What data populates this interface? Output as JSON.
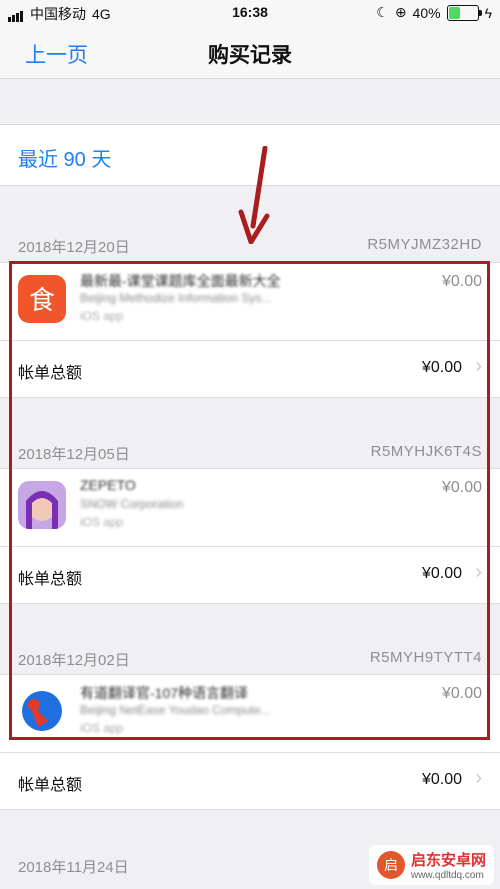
{
  "status": {
    "carrier": "中国移动",
    "network": "4G",
    "time": "16:38",
    "battery_pct": "40%",
    "battery_fill": 0.4
  },
  "nav": {
    "back_label": "上一页",
    "title": "购买记录"
  },
  "filter": {
    "label": "最近 90 天"
  },
  "sections": [
    {
      "date": "2018年12月20日",
      "order_id": "R5MYJMZ32HD",
      "item": {
        "name": "最新最-课堂课题库全面最新大全",
        "developer": "Beijing Methodize Information Sys...",
        "platform": "iOS app",
        "price": "¥0.00",
        "icon": "book-app-icon"
      },
      "total_label": "帐单总额",
      "total_amount": "¥0.00"
    },
    {
      "date": "2018年12月05日",
      "order_id": "R5MYHJK6T4S",
      "item": {
        "name": "ZEPETO",
        "developer": "SNOW Corporation",
        "platform": "iOS app",
        "price": "¥0.00",
        "icon": "avatar-app-icon"
      },
      "total_label": "帐单总额",
      "total_amount": "¥0.00"
    },
    {
      "date": "2018年12月02日",
      "order_id": "R5MYH9TYTT4",
      "item": {
        "name": "有道翻译官-107种语言翻译",
        "developer": "Beijing NetEase Youdao Compute...",
        "platform": "iOS app",
        "price": "¥0.00",
        "icon": "translate-app-icon"
      },
      "total_label": "帐单总额",
      "total_amount": "¥0.00"
    }
  ],
  "next_section": {
    "date": "2018年11月24日"
  },
  "watermark": {
    "name": "启东安卓网",
    "url": "www.qdltdq.com"
  },
  "colors": {
    "accent": "#1f7ff6",
    "highlight": "#a81d1d"
  }
}
